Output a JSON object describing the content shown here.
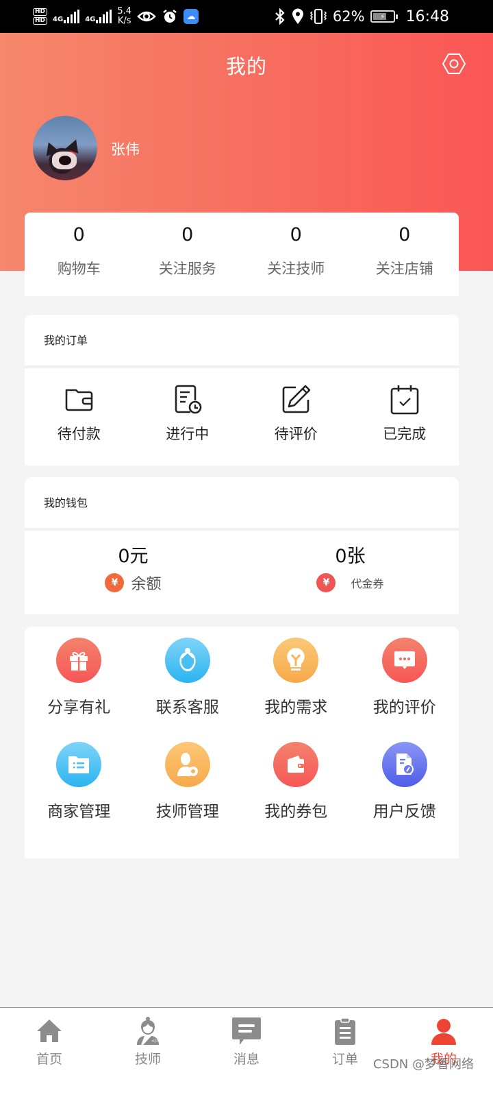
{
  "status_bar": {
    "sim1": "HD",
    "sim2": "HD",
    "net1": "4G",
    "net2": "4G",
    "speed_value": "5.4",
    "speed_unit": "K/s",
    "battery_percent": "62%",
    "time": "16:48",
    "icons": [
      "eye-icon",
      "alarm-icon",
      "cloud-app-icon",
      "bluetooth-icon",
      "location-icon",
      "vibrate-icon",
      "battery-charging-icon"
    ]
  },
  "header": {
    "title": "我的",
    "settings_icon": "settings-hexagon-icon",
    "username": "张伟"
  },
  "stats": [
    {
      "value": "0",
      "label": "购物车"
    },
    {
      "value": "0",
      "label": "关注服务"
    },
    {
      "value": "0",
      "label": "关注技师"
    },
    {
      "value": "0",
      "label": "关注店铺"
    }
  ],
  "orders": {
    "title": "我的订单",
    "items": [
      {
        "label": "待付款",
        "icon": "wallet-icon"
      },
      {
        "label": "进行中",
        "icon": "document-clock-icon"
      },
      {
        "label": "待评价",
        "icon": "edit-icon"
      },
      {
        "label": "已完成",
        "icon": "calendar-check-icon"
      }
    ]
  },
  "wallet": {
    "title": "我的钱包",
    "balance": {
      "value": "0元",
      "label": "余额",
      "icon": "yuan-bag-icon",
      "color": "#f06a3c"
    },
    "coupons": {
      "value": "0张",
      "label": "代金券",
      "icon": "ticket-icon",
      "color": "#f05555"
    }
  },
  "tools": [
    {
      "label": "分享有礼",
      "icon": "gift-icon",
      "colors": [
        "#f4826c",
        "#f65757"
      ]
    },
    {
      "label": "联系客服",
      "icon": "customer-service-icon",
      "colors": [
        "#7fd4f7",
        "#2bb4f0"
      ]
    },
    {
      "label": "我的需求",
      "icon": "lightbulb-icon",
      "colors": [
        "#fbc877",
        "#f7a94a"
      ]
    },
    {
      "label": "我的评价",
      "icon": "comment-icon",
      "colors": [
        "#f4826c",
        "#f65757"
      ]
    },
    {
      "label": "商家管理",
      "icon": "folder-list-icon",
      "colors": [
        "#7fd4f7",
        "#2bb4f0"
      ]
    },
    {
      "label": "技师管理",
      "icon": "user-settings-icon",
      "colors": [
        "#fbc877",
        "#f7a94a"
      ]
    },
    {
      "label": "我的券包",
      "icon": "wallet-icon",
      "colors": [
        "#f4826c",
        "#f65757"
      ]
    },
    {
      "label": "用户反馈",
      "icon": "feedback-document-icon",
      "colors": [
        "#8b95f5",
        "#4d5de8"
      ]
    }
  ],
  "tabbar": {
    "items": [
      {
        "label": "首页",
        "icon": "home-icon",
        "active": false
      },
      {
        "label": "技师",
        "icon": "technician-icon",
        "active": false
      },
      {
        "label": "消息",
        "icon": "message-icon",
        "active": false
      },
      {
        "label": "订单",
        "icon": "clipboard-icon",
        "active": false
      },
      {
        "label": "我的",
        "icon": "user-icon",
        "active": true
      }
    ],
    "active_color": "#ee4433",
    "inactive_color": "#888888"
  },
  "watermark": "CSDN @梦香网络",
  "colors": {
    "header_gradient_start": "#f5876c",
    "header_gradient_end": "#fb5656",
    "page_bg": "#f4f4f4"
  }
}
